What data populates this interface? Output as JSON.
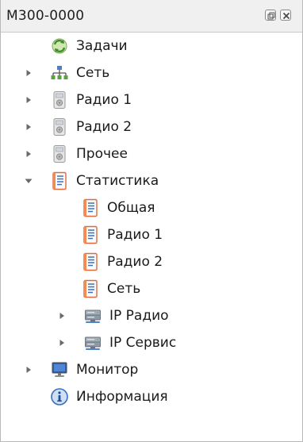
{
  "panel": {
    "title": "M300-0000",
    "float_icon": "float-window-icon",
    "close_icon": "close-icon"
  },
  "tree": [
    {
      "label": "Задачи",
      "icon": "tasks-icon",
      "expander": "none",
      "level": 0
    },
    {
      "label": "Сеть",
      "icon": "network-icon",
      "expander": "collapsed",
      "level": 0
    },
    {
      "label": "Радио 1",
      "icon": "radio-device-icon",
      "expander": "collapsed",
      "level": 0
    },
    {
      "label": "Радио 2",
      "icon": "radio-device-icon",
      "expander": "collapsed",
      "level": 0
    },
    {
      "label": "Прочее",
      "icon": "radio-device-icon",
      "expander": "collapsed",
      "level": 0
    },
    {
      "label": "Статистика",
      "icon": "statistics-icon",
      "expander": "expanded",
      "level": 0
    },
    {
      "label": "Общая",
      "icon": "statistics-icon",
      "expander": "none",
      "level": 1
    },
    {
      "label": "Радио 1",
      "icon": "statistics-icon",
      "expander": "none",
      "level": 1
    },
    {
      "label": "Радио 2",
      "icon": "statistics-icon",
      "expander": "none",
      "level": 1
    },
    {
      "label": "Сеть",
      "icon": "statistics-icon",
      "expander": "none",
      "level": 1
    },
    {
      "label": "IP Радио",
      "icon": "server-icon",
      "expander": "collapsed",
      "level": 1
    },
    {
      "label": "IP Сервис",
      "icon": "server-icon",
      "expander": "collapsed",
      "level": 1
    },
    {
      "label": "Монитор",
      "icon": "monitor-icon",
      "expander": "collapsed",
      "level": 0
    },
    {
      "label": "Информация",
      "icon": "info-icon",
      "expander": "none",
      "level": 0
    }
  ]
}
